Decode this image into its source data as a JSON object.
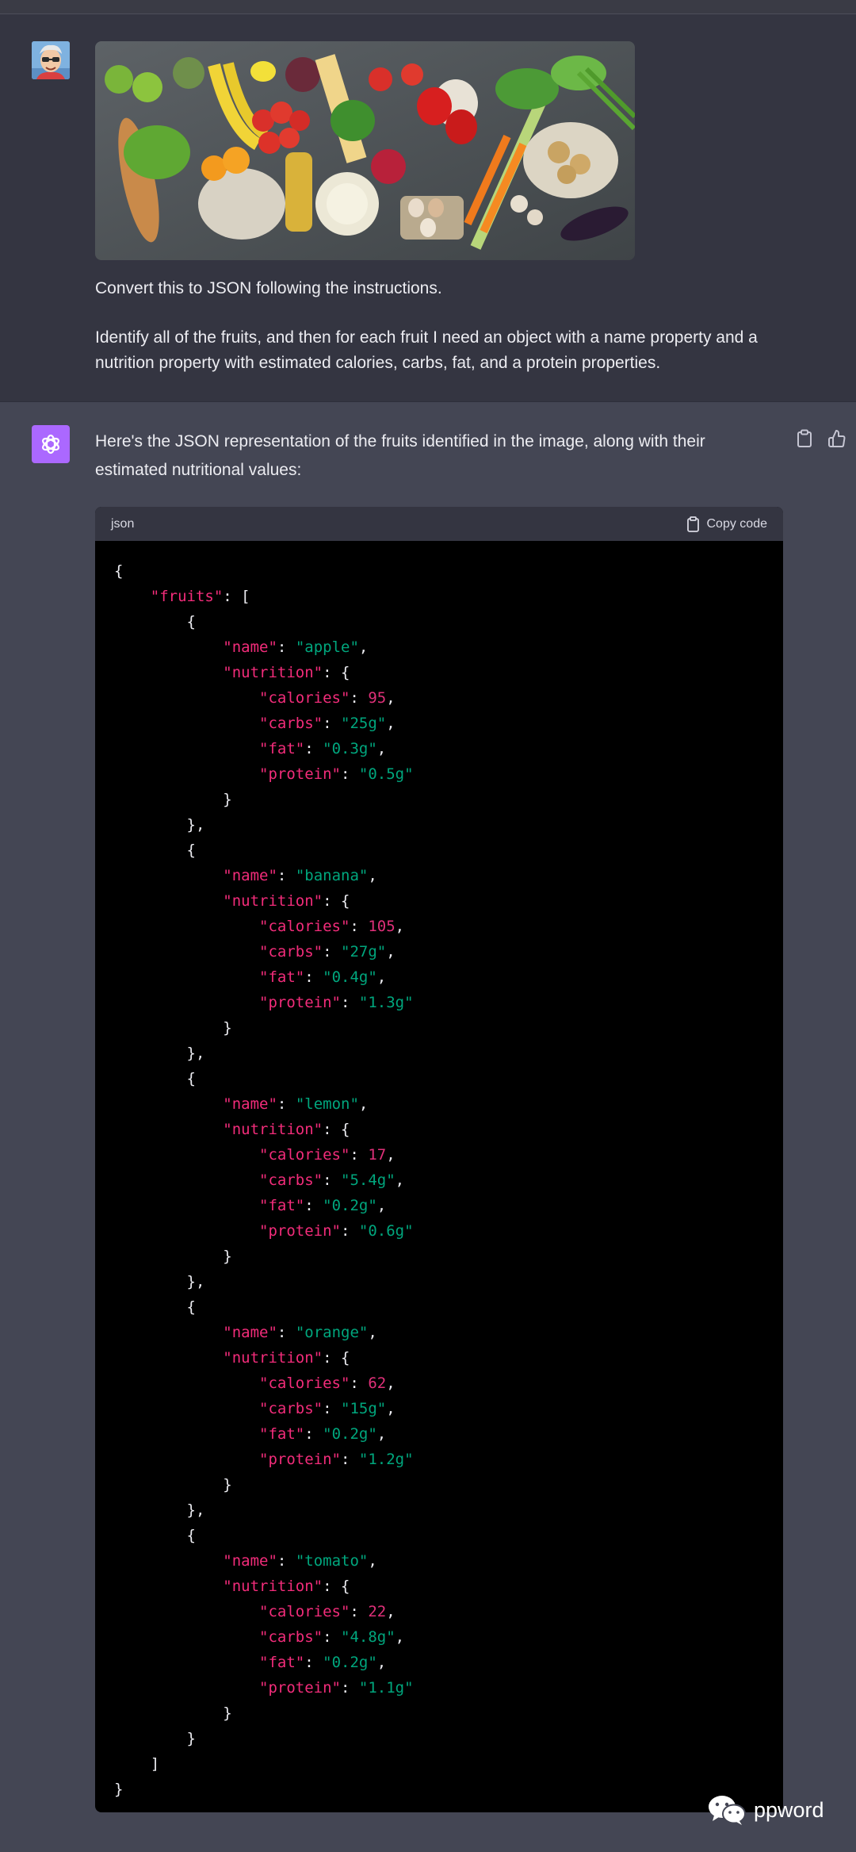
{
  "user_message": {
    "line1": "Convert this to JSON following the instructions.",
    "line2": "Identify all of the fruits, and then for each fruit I need an object with a name property and a",
    "line3": "nutrition property with estimated calories, carbs, fat, and a protein properties."
  },
  "assistant_message": {
    "intro_line1": "Here's the JSON representation of the fruits identified in the image, along with their",
    "intro_line2": "estimated nutritional values:",
    "code_language": "json",
    "copy_label": "Copy code"
  },
  "json_content": {
    "root_key": "fruits",
    "fruits": [
      {
        "name": "apple",
        "calories": 95,
        "carbs": "25g",
        "fat": "0.3g",
        "protein": "0.5g"
      },
      {
        "name": "banana",
        "calories": 105,
        "carbs": "27g",
        "fat": "0.4g",
        "protein": "1.3g"
      },
      {
        "name": "lemon",
        "calories": 17,
        "carbs": "5.4g",
        "fat": "0.2g",
        "protein": "0.6g"
      },
      {
        "name": "orange",
        "calories": 62,
        "carbs": "15g",
        "fat": "0.2g",
        "protein": "1.2g"
      },
      {
        "name": "tomato",
        "calories": 22,
        "carbs": "4.8g",
        "fat": "0.2g",
        "protein": "1.1g"
      }
    ]
  },
  "watermark": "ppword",
  "icons": {
    "clipboard": "clipboard-icon",
    "thumbs_up": "thumbs-up-icon",
    "bot_logo": "openai-logo-icon",
    "wechat": "wechat-icon"
  },
  "colors": {
    "bot_avatar": "#ab68ff",
    "json_key": "#f22c7a",
    "json_string": "#00a67d",
    "json_number": "#df3079"
  }
}
